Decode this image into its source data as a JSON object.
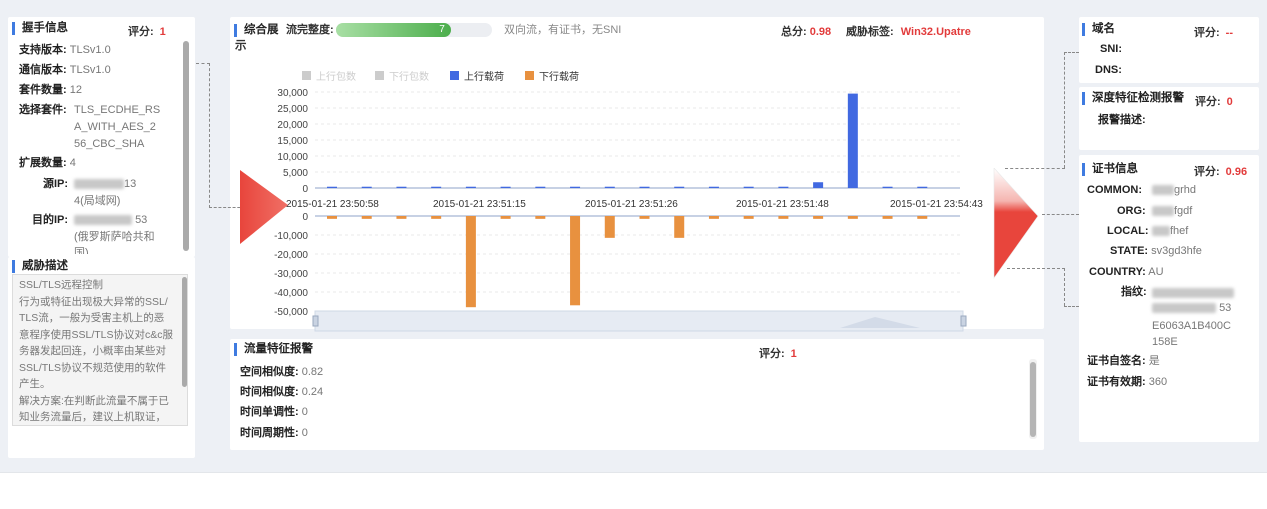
{
  "handshake": {
    "title": "握手信息",
    "score_label": "评分:",
    "score_value": "1",
    "rows": [
      {
        "k": "支持版本:",
        "v": "TLSv1.0"
      },
      {
        "k": "通信版本:",
        "v": "TLSv1.0"
      },
      {
        "k": "套件数量:",
        "v": "12"
      },
      {
        "k": "选择套件:",
        "v": "TLS_ECDHE_RSA_WITH_AES_256_CBC_SHA",
        "lines": [
          "TLS_ECDHE_RS",
          "A_WITH_AES_2",
          "56_CBC_SHA"
        ]
      },
      {
        "k": "扩展数量:",
        "v": "4"
      },
      {
        "k": "源IP:",
        "v_tail": "13",
        "v2": "4(局域网)"
      },
      {
        "k": "目的IP:",
        "v_tail": "53",
        "v2": "(俄罗斯萨哈共和",
        "v3": "国)"
      }
    ]
  },
  "threat_desc": {
    "title": "威胁描述",
    "text": "SSL/TLS远程控制\n行为或特征出现极大异常的SSL/TLS流，一般为受害主机上的恶意程序使用SSL/TLS协议对c&c服务器发起回连，小概率由某些对SSL/TLS协议不规范使用的软件产生。\n解决方案:在判断此流量不属于已知业务流量后，建议上机取证，",
    "lines": [
      "SSL/TLS远程控制",
      "行为或特征出现极大异常的SSL/",
      "TLS流，一般为受害主机上的恶",
      "意程序使用SSL/TLS协议对c&c服",
      "务器发起回连，小概率由某些对",
      "SSL/TLS协议不规范使用的软件",
      "产生。",
      "解决方案:在判断此流量不属于已",
      "知业务流量后，建议上机取证，"
    ]
  },
  "overview": {
    "title": "综合展",
    "title2": "示",
    "integrity_label": "流完整度:",
    "integrity_value": "7",
    "integrity_progress": 0.74,
    "flow_desc": "双向流，有证书，无SNI",
    "total_label": "总分:",
    "total_value": "0.98",
    "threat_tag_label": "威胁标签:",
    "threat_tag_value": "Win32.Upatre"
  },
  "chart_data": {
    "type": "bar",
    "legend": [
      {
        "name": "上行包数",
        "color": "#cccccc",
        "active": false
      },
      {
        "name": "下行包数",
        "color": "#cccccc",
        "active": false
      },
      {
        "name": "上行载荷",
        "color": "#4169e1",
        "active": true
      },
      {
        "name": "下行载荷",
        "color": "#e8913f",
        "active": true
      }
    ],
    "y_ticks": [
      "30,000",
      "25,000",
      "20,000",
      "15,000",
      "10,000",
      "5,000",
      "0",
      "-10,000",
      "-20,000",
      "-30,000",
      "-40,000",
      "-50,000"
    ],
    "x_labels": [
      "2015-01-21 23:50:58",
      "2015-01-21 23:51:15",
      "2015-01-21 23:51:26",
      "2015-01-21 23:51:48",
      "2015-01-21 23:54:43"
    ],
    "series": [
      {
        "name": "上行载荷",
        "color": "#4169e1",
        "values": [
          400,
          400,
          400,
          400,
          400,
          400,
          400,
          400,
          400,
          400,
          400,
          400,
          400,
          400,
          1800,
          29500,
          400,
          400
        ]
      },
      {
        "name": "下行载荷",
        "color": "#e8913f",
        "values": [
          -1500,
          -1500,
          -1500,
          -1500,
          -48000,
          -1500,
          -1500,
          -47000,
          -11500,
          -1500,
          -11500,
          -1500,
          -1500,
          -1500,
          -1500,
          -1500,
          -1500,
          -1500
        ]
      }
    ],
    "ylim": [
      -50000,
      30000
    ]
  },
  "flow_alarm": {
    "title": "流量特征报警",
    "score_label": "评分:",
    "score_value": "1",
    "rows": [
      {
        "k": "空间相似度:",
        "v": "0.82"
      },
      {
        "k": "时间相似度:",
        "v": "0.24"
      },
      {
        "k": "时间单调性:",
        "v": "0"
      },
      {
        "k": "时间周期性:",
        "v": "0"
      }
    ]
  },
  "domain": {
    "title": "域名",
    "score_label": "评分:",
    "score_value": "--",
    "rows": [
      {
        "k": "SNI:",
        "v": ""
      },
      {
        "k": "DNS:",
        "v": ""
      }
    ]
  },
  "deep_alarm": {
    "title": "深度特征检测报警",
    "score_label": "评分:",
    "score_value": "0",
    "rows": [
      {
        "k": "报警描述:",
        "v": ""
      }
    ]
  },
  "cert": {
    "title": "证书信息",
    "score_label": "评分:",
    "score_value": "0.96",
    "rows": [
      {
        "k": "COMMON:",
        "v": "grhd"
      },
      {
        "k": "ORG:",
        "v": "fgdf"
      },
      {
        "k": "LOCAL:",
        "v": "fhef"
      },
      {
        "k": "STATE:",
        "v": "sv3gd3hfe"
      },
      {
        "k": "COUNTRY:",
        "v": "AU"
      },
      {
        "k": "指纹:",
        "v": "53",
        "v2": "E6063A1B400C",
        "v3": "158E"
      },
      {
        "k": "证书自签名:",
        "v": "是"
      },
      {
        "k": "证书有效期:",
        "v": "360"
      }
    ]
  },
  "colors": {
    "accent": "#3f7be0",
    "score": "#e23b3b",
    "arrow": "#e8453c",
    "upload": "#4169e1",
    "download": "#e8913f",
    "progress": "#5cb85c"
  }
}
